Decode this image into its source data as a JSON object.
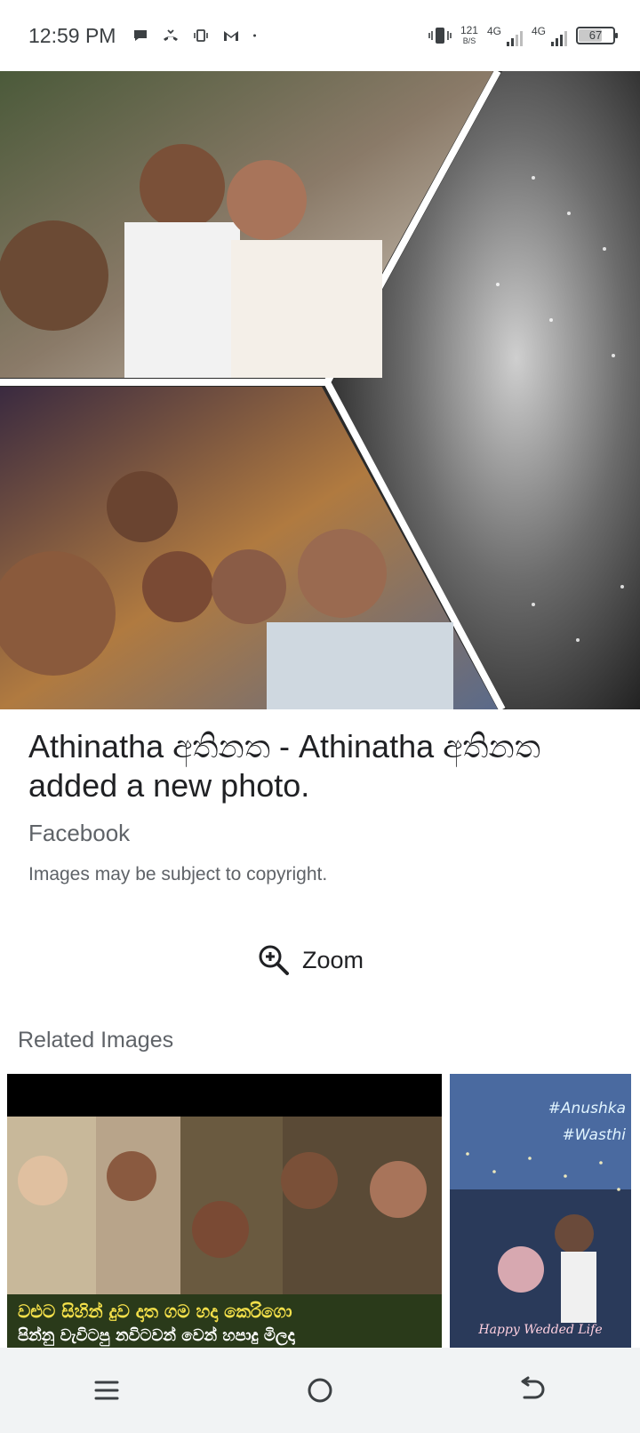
{
  "status_bar": {
    "time": "12:59 PM",
    "net_speed_value": "121",
    "net_speed_unit": "B/S",
    "sim1_label": "4G",
    "sim2_label": "4G",
    "battery": "67",
    "notification_icons": [
      "chat-icon",
      "missed-call-icon",
      "vibrate-icon",
      "gmail-icon",
      "dot-icon"
    ]
  },
  "image": {
    "title": "Athinatha අතිනත - Athinatha අතිනත added a new photo.",
    "source": "Facebook",
    "copyright_note": "Images may be subject to copyright."
  },
  "actions": {
    "zoom_label": "Zoom"
  },
  "related": {
    "heading": "Related Images",
    "items": [
      {
        "caption_line1": "වළුට සිහින් දුව දාත ගම හදා කෙරිගො",
        "caption_line2": "පින්නු වැවිටපු නවිටවන් වෙන් හපාදු මිලදා"
      },
      {
        "tag1": "#Anushka",
        "tag2": "#Wasthi",
        "footer": "Happy Wedded Life"
      }
    ]
  },
  "nav": {
    "icons": [
      "menu-icon",
      "home-icon",
      "back-icon"
    ]
  }
}
